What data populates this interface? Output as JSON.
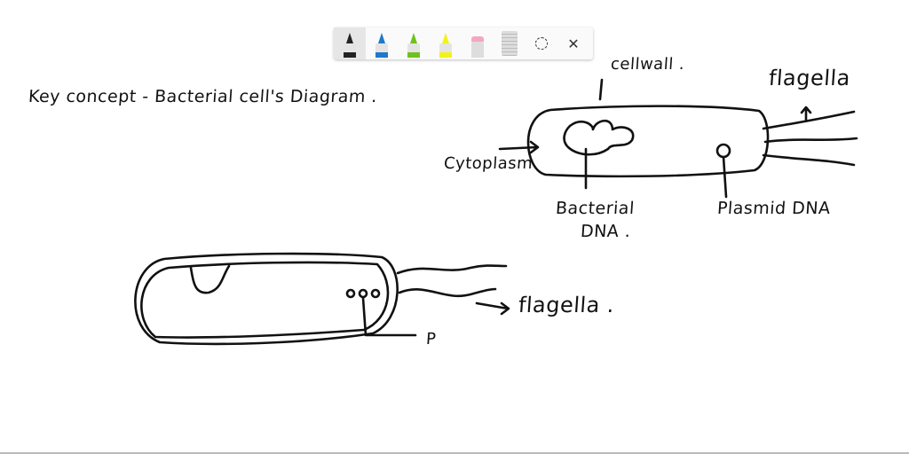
{
  "toolbar": {
    "tools": [
      {
        "name": "black-pen",
        "color": "#222222",
        "selected": true
      },
      {
        "name": "blue-pen",
        "color": "#1f78c8",
        "selected": false
      },
      {
        "name": "green-pen",
        "color": "#6dc21e",
        "selected": false
      },
      {
        "name": "yellow-highlighter",
        "color": "#f2f21a",
        "selected": false
      },
      {
        "name": "eraser",
        "color": "#f4a7c0",
        "selected": false
      }
    ],
    "ruler_icon": "ruler-icon",
    "lasso_icon": "lasso-select-icon",
    "close_icon": "close-icon"
  },
  "notes": {
    "heading": "Key concept -   Bacterial cell's  Diagram .",
    "cell_wall": "cellwall .",
    "flagella_top": "flagella",
    "cytoplasm": "Cytoplasm",
    "bacterial_dna_1": "Bacterial",
    "bacterial_dna_2": "DNA .",
    "plasmid_dna": "Plasmid DNA",
    "flagella_bottom": "flagella .",
    "p_label": "P"
  }
}
